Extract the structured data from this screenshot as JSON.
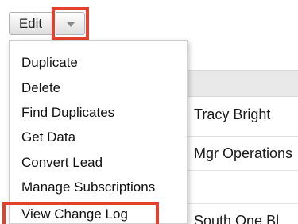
{
  "toolbar": {
    "edit_label": "Edit",
    "dropdown_icon": "chevron-down-icon"
  },
  "record": {
    "name": "Tracy Bright",
    "title": "Mgr Operations",
    "address": "South One Bl"
  },
  "menu": {
    "items": [
      {
        "label": "Duplicate"
      },
      {
        "label": "Delete"
      },
      {
        "label": "Find Duplicates"
      },
      {
        "label": "Get Data"
      },
      {
        "label": "Convert Lead"
      },
      {
        "label": "Manage Subscriptions"
      },
      {
        "label": "View Change Log"
      }
    ]
  },
  "colors": {
    "highlight": "#e4412d"
  }
}
